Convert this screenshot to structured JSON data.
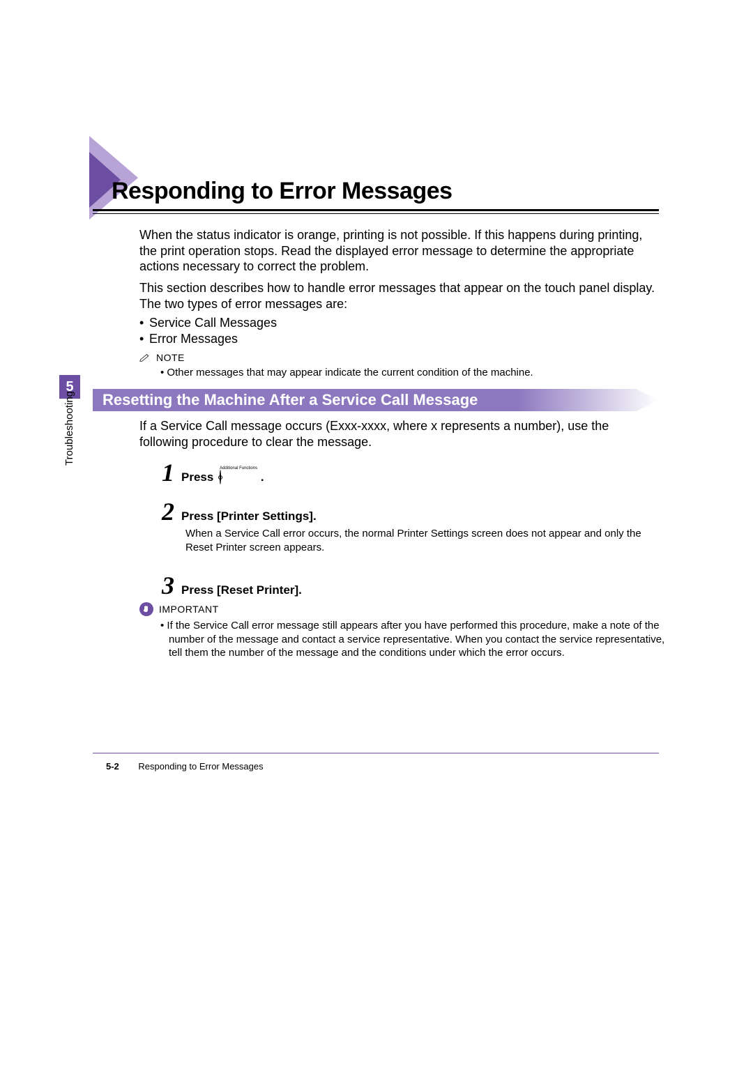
{
  "chapter_tab": "5",
  "side_label": "Troubleshooting",
  "title": "Responding to Error Messages",
  "intro1": "When the status indicator is orange, printing is not possible. If this happens during printing, the print operation stops. Read the displayed error message to determine the appropriate actions necessary to correct the problem.",
  "intro2": "This section describes how to handle error messages that appear on the touch panel display. The two types of error messages are:",
  "bullets": [
    "Service Call Messages",
    "Error Messages"
  ],
  "note_label": "NOTE",
  "note_text": "Other messages that may appear indicate the current condition of the machine.",
  "subheading": "Resetting the Machine After a Service Call Message",
  "sub_intro": "If a Service Call message occurs (Exxx-xxxx, where x represents a number), use the following procedure to clear the message.",
  "steps": {
    "s1_num": "1",
    "s1_text": "Press",
    "s1_icon_label": "Additional Functions",
    "s1_tail": ".",
    "s2_num": "2",
    "s2_text": "Press [Printer Settings].",
    "s2_body": "When a Service Call error occurs, the normal Printer Settings screen does not appear and only the Reset Printer screen appears.",
    "s3_num": "3",
    "s3_text": "Press [Reset Printer]."
  },
  "important_label": "IMPORTANT",
  "important_text": "If the Service Call error message still appears after you have performed this procedure, make a note of the number of the message and contact a service representative. When you contact the service representative, tell them the number of the message and the conditions under which the error occurs.",
  "footer_page": "5-2",
  "footer_title": "Responding to Error Messages"
}
